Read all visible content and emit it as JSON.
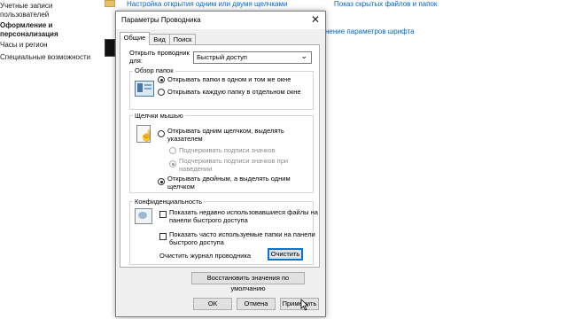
{
  "background": {
    "sidebar": {
      "item1_line1": "Учетные записи",
      "item1_line2": "пользователей",
      "item2_line1": "Оформление и",
      "item2_line2": "персонализация",
      "item3": "Часы и регион",
      "item4": "Специальные возможности"
    },
    "links": {
      "top_left": "Настройка открытия одним или двумя щелчками",
      "top_right": "Показ скрытых файлов и папок",
      "font_settings": "нение параметров шрифта"
    }
  },
  "dialog": {
    "title": "Параметры Проводника",
    "close_glyph": "✕",
    "tabs": [
      {
        "label": "Общие"
      },
      {
        "label": "Вид"
      },
      {
        "label": "Поиск"
      }
    ],
    "open_explorer": {
      "label_line1": "Открыть проводник",
      "label_line2": "для:",
      "value": "Быстрый доступ",
      "arrow": "⌄"
    },
    "browse_folders": {
      "title": "Обзор папок",
      "option1": "Открывать папки в одном и том же окне",
      "option2": "Открывать каждую папку в отдельном окне",
      "selected": 1
    },
    "clicks": {
      "title": "Щелчки мышью",
      "option1_line1": "Открывать одним щелчком, выделять",
      "option1_line2": "указателем",
      "sub1": "Подчеркивать подписи значков",
      "sub2_line1": "Подчеркивать подписи значков при",
      "sub2_line2": "наведении",
      "option2_line1": "Открывать двойным, а выделять одним",
      "option2_line2": "щелчком",
      "selected": 2
    },
    "privacy": {
      "title": "Конфиденциальность",
      "check1_line1": "Показать недавно использовавшиеся файлы на",
      "check1_line2": "панели быстрого доступа",
      "check2_line1": "Показать часто используемые папки на панели",
      "check2_line2": "быстрого доступа",
      "clear_label": "Очистить журнал проводника",
      "clear_button": "Очистить"
    },
    "restore_defaults": "Восстановить значения по умолчанию",
    "footer": {
      "ok": "ОК",
      "cancel": "Отмена",
      "apply": "Применить"
    }
  },
  "colors": {
    "accent": "#0078d7",
    "link": "#0066cc"
  }
}
